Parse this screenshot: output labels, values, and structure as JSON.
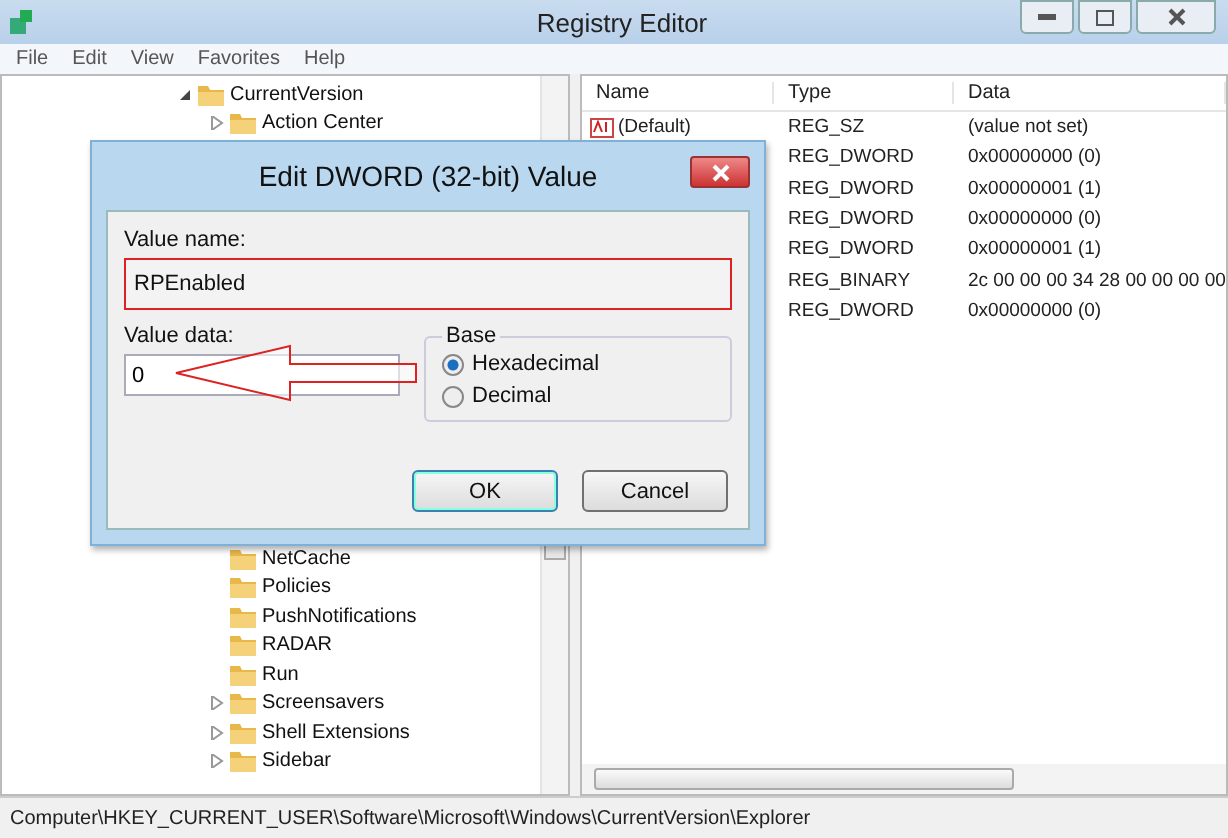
{
  "window": {
    "title": "Registry Editor"
  },
  "menu": [
    "File",
    "Edit",
    "View",
    "Favorites",
    "Help"
  ],
  "tree": {
    "top": [
      {
        "label": "CurrentVersion",
        "expanded": true,
        "expandable": true
      },
      {
        "label": "Action Center",
        "expanded": false,
        "expandable": true
      }
    ],
    "bottom": [
      {
        "label": "NetCache",
        "expandable": false
      },
      {
        "label": "Policies",
        "expandable": false
      },
      {
        "label": "PushNotifications",
        "expandable": false
      },
      {
        "label": "RADAR",
        "expandable": false
      },
      {
        "label": "Run",
        "expandable": false
      },
      {
        "label": "Screensavers",
        "expandable": true
      },
      {
        "label": "Shell Extensions",
        "expandable": true
      },
      {
        "label": "Sidebar",
        "expandable": true
      }
    ]
  },
  "table": {
    "columns": [
      "Name",
      "Type",
      "Data"
    ],
    "rows": [
      {
        "name": "(Default)",
        "type": "REG_SZ",
        "data": "(value not set)"
      },
      {
        "type": "REG_DWORD",
        "data": "0x00000000 (0)"
      },
      {
        "type": "REG_DWORD",
        "data": "0x00000001 (1)"
      },
      {
        "type": "REG_DWORD",
        "data": "0x00000000 (0)"
      },
      {
        "type": "REG_DWORD",
        "data": "0x00000001 (1)"
      },
      {
        "type": "REG_BINARY",
        "data": "2c 00 00 00 34 28 00 00 00 00"
      },
      {
        "type": "REG_DWORD",
        "data": "0x00000000 (0)"
      }
    ]
  },
  "status_bar": "Computer\\HKEY_CURRENT_USER\\Software\\Microsoft\\Windows\\CurrentVersion\\Explorer",
  "dialog": {
    "title": "Edit DWORD (32-bit) Value",
    "value_name_label": "Value name:",
    "value_name": "RPEnabled",
    "value_data_label": "Value data:",
    "value_data": "0",
    "base_label": "Base",
    "bases": [
      {
        "label": "Hexadecimal",
        "selected": true
      },
      {
        "label": "Decimal",
        "selected": false
      }
    ],
    "buttons": [
      {
        "label": "OK",
        "default": true
      },
      {
        "label": "Cancel",
        "default": false
      }
    ]
  }
}
